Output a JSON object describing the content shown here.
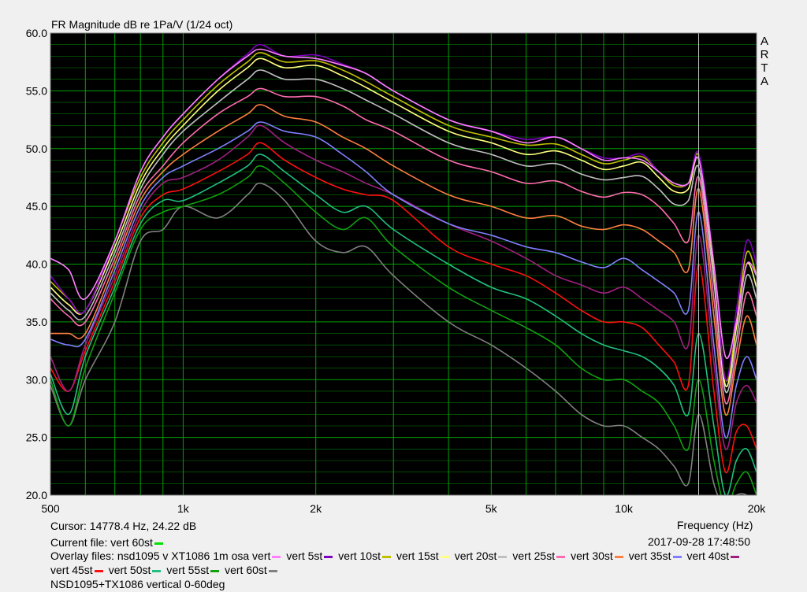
{
  "title": "FR Magnitude dB re 1Pa/V (1/24 oct)",
  "arta_letters": [
    "A",
    "R",
    "T",
    "A"
  ],
  "cursor_text": "Cursor: 14778.4 Hz, 24.22 dB",
  "frequency_label": "Frequency (Hz)",
  "current_file_label": "Current file: vert 60st",
  "current_file_color": "#00e000",
  "date_time": "2017-09-28  17:48:50",
  "overlay_prefix": "Overlay files: ",
  "footer_label": "NSD1095+TX1086 vertical 0-60deg",
  "chart_data": {
    "type": "line",
    "title": "FR Magnitude dB re 1Pa/V (1/24 oct)",
    "xlabel": "Frequency (Hz)",
    "ylabel": "",
    "x_scale": "log",
    "xlim": [
      500,
      20000
    ],
    "ylim": [
      20,
      60
    ],
    "x_ticks": [
      {
        "v": 500,
        "label": "500"
      },
      {
        "v": 1000,
        "label": "1k"
      },
      {
        "v": 2000,
        "label": "2k"
      },
      {
        "v": 5000,
        "label": "5k"
      },
      {
        "v": 10000,
        "label": "10k"
      },
      {
        "v": 20000,
        "label": "20k"
      }
    ],
    "y_ticks": [
      {
        "v": 20,
        "label": "20.0"
      },
      {
        "v": 25,
        "label": "25.0"
      },
      {
        "v": 30,
        "label": "30.0"
      },
      {
        "v": 35,
        "label": "35.0"
      },
      {
        "v": 40,
        "label": "40.0"
      },
      {
        "v": 45,
        "label": "45.0"
      },
      {
        "v": 50,
        "label": "50.0"
      },
      {
        "v": 55,
        "label": "55.0"
      },
      {
        "v": 60,
        "label": "60.0"
      }
    ],
    "grid": true,
    "background": "#000000",
    "grid_color": "#00a000",
    "cursor_frequency": 14778.4,
    "x": [
      500,
      550,
      600,
      700,
      800,
      900,
      1000,
      1200,
      1400,
      1500,
      1700,
      2000,
      2300,
      2600,
      3000,
      4000,
      5000,
      6000,
      7000,
      8000,
      9000,
      10000,
      11000,
      12000,
      13000,
      14000,
      14800,
      16000,
      17000,
      18000,
      19000,
      20000
    ],
    "series": [
      {
        "name": "nsd1095 v XT1086 1m osa vert",
        "color": "#ff80ff",
        "values": [
          40.5,
          39.5,
          37,
          42,
          48,
          51,
          53,
          56,
          58,
          58.6,
          58,
          57.8,
          57.2,
          56.5,
          55,
          52.5,
          51.5,
          50.5,
          51,
          50,
          49,
          49.2,
          49,
          48,
          47,
          47,
          49,
          40,
          32,
          35,
          40,
          39
        ]
      },
      {
        "name": "vert 5st",
        "color": "#8000c0",
        "values": [
          39,
          37,
          36,
          42,
          48,
          51,
          53,
          56,
          58.2,
          59,
          58,
          58.1,
          57.3,
          56.5,
          55,
          52.5,
          51.5,
          50.8,
          51,
          50,
          49.2,
          49.2,
          49.5,
          48,
          47,
          47,
          49.5,
          40,
          30,
          36,
          42,
          40
        ]
      },
      {
        "name": "vert 10st",
        "color": "#c0c000",
        "values": [
          38.5,
          37,
          36,
          42,
          47.5,
          50.5,
          52.5,
          55.5,
          57.5,
          58.3,
          57.5,
          57.6,
          56.8,
          55.8,
          54.5,
          52,
          51,
          50.3,
          50.4,
          49.5,
          48.7,
          49,
          49.3,
          48,
          46.8,
          47,
          49.3,
          40,
          30,
          35,
          41,
          39
        ]
      },
      {
        "name": "vert 15st",
        "color": "#ffff80",
        "values": [
          38,
          36.5,
          36,
          41.5,
          47,
          50,
          52,
          55,
          57,
          57.8,
          57,
          57.2,
          56.3,
          55.3,
          54,
          51.5,
          50.5,
          49.5,
          49.8,
          49,
          48.2,
          48.5,
          48.8,
          47.5,
          46.3,
          46.5,
          49,
          39.5,
          29.5,
          34.5,
          40,
          38
        ]
      },
      {
        "name": "vert 20st",
        "color": "#c0c0c0",
        "values": [
          37.5,
          36,
          35.5,
          41,
          46.5,
          49.5,
          51.5,
          54,
          56,
          56.8,
          56,
          56,
          55.2,
          54.2,
          53,
          50.5,
          49.5,
          48.5,
          48.7,
          47.8,
          47.3,
          47.5,
          47.6,
          46.5,
          45.2,
          45.5,
          48.3,
          38.5,
          29,
          33.5,
          39,
          37
        ]
      },
      {
        "name": "vert 25st",
        "color": "#ff6cb0",
        "values": [
          37,
          35.5,
          35,
          40.5,
          46,
          48.5,
          50.5,
          53,
          54.5,
          55.2,
          54.5,
          54.5,
          53.7,
          52.5,
          51.5,
          49,
          48,
          47,
          47.2,
          46.3,
          45.8,
          46.2,
          46,
          45,
          43.5,
          42,
          47.5,
          37,
          28,
          32.5,
          37.5,
          35.5
        ]
      },
      {
        "name": "vert 30st",
        "color": "#ff8040",
        "values": [
          34,
          34,
          34,
          40,
          45.5,
          48,
          49.5,
          51.5,
          53,
          53.8,
          52.8,
          52.3,
          51,
          50,
          48.5,
          46,
          45,
          44,
          44.2,
          43.3,
          43,
          43.4,
          43,
          42,
          41,
          39.5,
          46.5,
          35.5,
          27,
          31.5,
          35.5,
          33
        ]
      },
      {
        "name": "vert 35st",
        "color": "#8080ff",
        "values": [
          33.5,
          33,
          33.5,
          39.5,
          45,
          47.5,
          48.5,
          50,
          51.5,
          52.3,
          51.5,
          51,
          49.5,
          48,
          46,
          43.5,
          42.5,
          41.5,
          41,
          40.2,
          39.7,
          40.5,
          39.5,
          38.5,
          37.5,
          36,
          44.5,
          33,
          25,
          29.5,
          32,
          30
        ]
      },
      {
        "name": "vert 40st",
        "color": "#a02080",
        "values": [
          32,
          29,
          33,
          39,
          44.5,
          47,
          47.5,
          49,
          51,
          52,
          50.5,
          49,
          48,
          47,
          46,
          43.5,
          42,
          40.5,
          39,
          38.2,
          37.5,
          38,
          37,
          36,
          35,
          33,
          42.5,
          31.5,
          24,
          28,
          29.5,
          28
        ]
      },
      {
        "name": "vert 45st",
        "color": "#ff1010",
        "values": [
          31,
          29,
          32.5,
          38.5,
          44,
          46,
          46.5,
          48,
          49.5,
          50.5,
          49,
          47.5,
          46.5,
          46,
          45.5,
          41.5,
          40,
          39,
          37.5,
          36,
          35,
          35,
          34.5,
          33,
          31.5,
          29.5,
          40,
          29,
          22,
          25.5,
          26,
          24
        ]
      },
      {
        "name": "vert 50st",
        "color": "#20c080",
        "values": [
          30.5,
          27,
          32,
          38,
          43.5,
          45.5,
          45.5,
          47,
          48.5,
          49.5,
          48,
          46,
          44.5,
          45,
          43,
          40,
          38,
          37,
          35.5,
          34,
          33,
          32.5,
          32,
          31,
          29.5,
          27,
          34,
          26,
          20,
          23,
          24,
          22
        ]
      },
      {
        "name": "vert 55st",
        "color": "#10a010",
        "values": [
          30,
          26,
          31,
          37.5,
          43,
          44.5,
          45,
          46,
          47.5,
          48.5,
          47,
          44.5,
          43,
          44,
          41.5,
          38,
          36,
          34.5,
          33,
          31,
          30,
          30,
          29,
          28,
          26,
          24,
          30,
          23,
          19,
          21,
          22,
          20
        ]
      },
      {
        "name": "vert 60st",
        "color": "#808080",
        "values": [
          29.5,
          26,
          30,
          35,
          42,
          43,
          45,
          44,
          46,
          47,
          45.5,
          42,
          41,
          41.5,
          39,
          35,
          33,
          31,
          29,
          27,
          26,
          26,
          25,
          24,
          22.5,
          21,
          27,
          21,
          19,
          20,
          20,
          19
        ]
      }
    ]
  }
}
